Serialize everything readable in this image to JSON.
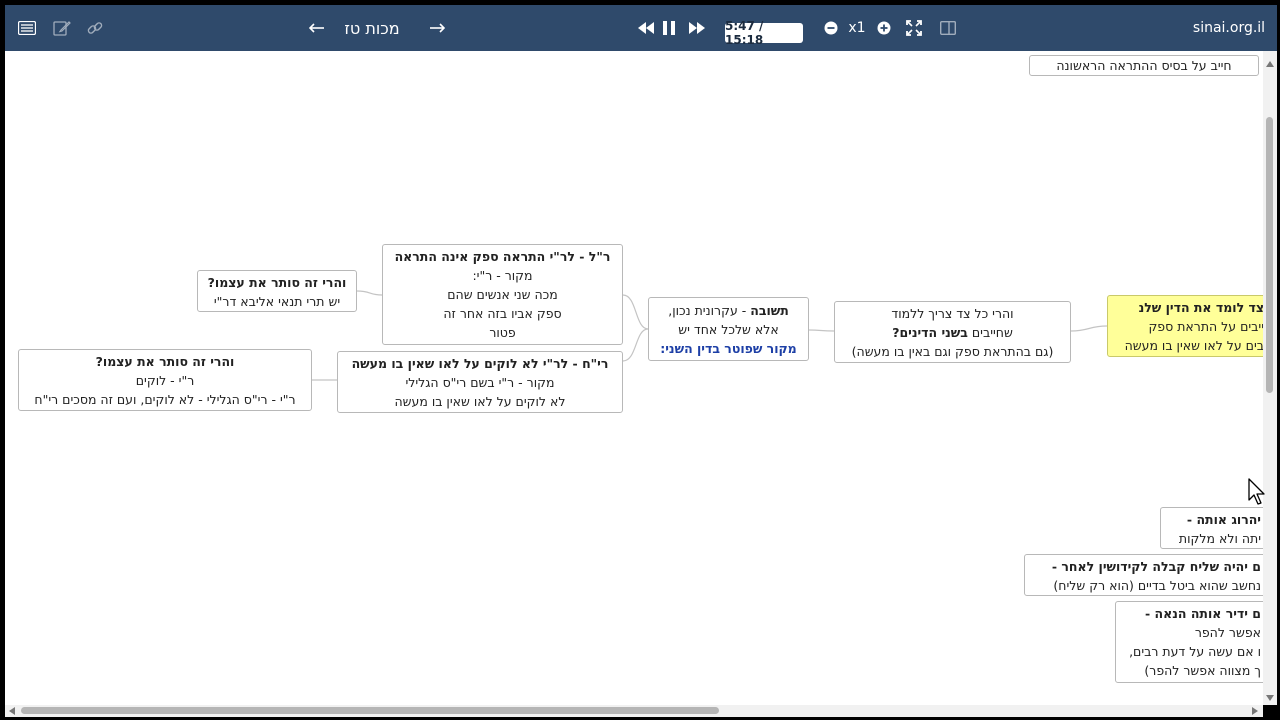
{
  "toolbar": {
    "icons": [
      "list-icon",
      "edit-icon",
      "link-icon",
      "arrow-left-icon",
      "arrow-right-icon",
      "rewind-icon",
      "pause-icon",
      "fast-forward-icon",
      "zoom-out-icon",
      "zoom-in-icon",
      "fullscreen-icon",
      "split-view-icon"
    ],
    "title": "מכות טז",
    "time": "5:47 / 15:18",
    "speed": "x1",
    "site": "sinai.org.il"
  },
  "colors": {
    "toolbar_bg": "#2f4a6b",
    "highlight_node": "#ffff99",
    "link_text": "#1d3fa6"
  },
  "nodes": {
    "top_partial": {
      "line1": "חייב על בסיס ההתראה הראשונה"
    },
    "contradiction_1": {
      "line1": "והרי זה סותר את עצמו?",
      "line2": "יש תרי תנאי אליבא דר\"י"
    },
    "resh_lakish": {
      "line1": "ר\"ל -  לר\"י התראה ספק אינה התראה",
      "line2": "מקור - ר\"י:",
      "line3": "מכה שני אנשים שהם",
      "line4": "ספק אביו בזה אחר זה",
      "line5": "פטור"
    },
    "contradiction_2": {
      "line1": "והרי זה סותר את עצמו?",
      "line2": "ר\"י - לוקים",
      "line3": "ר\"י - רי\"ס הגלילי - לא לוקים, ועם זה מסכים רי\"ח"
    },
    "rabbi_yochanan": {
      "line1": "רי\"ח  -  לר\"י לא לוקים על לאו  שאין בו מעשה",
      "line2": "מקור - ר\"י בשם רי\"ס הגלילי",
      "line3": "לא לוקים על לאו שאין בו מעשה"
    },
    "answer": {
      "label": "תשובה",
      "line1_rest": " - עקרונית נכון,",
      "line2": "אלא שלכל אחד יש",
      "line3": "מקור שפוטר בדין השני:"
    },
    "both_laws": {
      "line1": "והרי כל צד צריך ללמוד",
      "line2a": "שחייבים ",
      "line2b": "בשני הדינים?",
      "line3": "(גם בהתראת ספק וגם באין בו מעשה)"
    },
    "highlight": {
      "line1": "צד לומד  את הדין שלנ",
      "line2": "ייבים על התראת ספק",
      "line3": "בים על לאו שאין בו מעשה"
    },
    "kill": {
      "line1": "יהרוג אותה -",
      "line2": "יתה ולא מלקות"
    },
    "agent": {
      "line1": "ם יהיה שליח קבלה לקידושין לאחר -",
      "line2": "נחשב שהוא ביטל בדיים (הוא רק שליח)"
    },
    "vow": {
      "line1": "ם ידיר אותה הנאה  -",
      "line2": "אפשר להפר",
      "line3": "ו אם עשה על דעת רבים,",
      "line4": "ך מצווה אפשר להפר)"
    }
  }
}
